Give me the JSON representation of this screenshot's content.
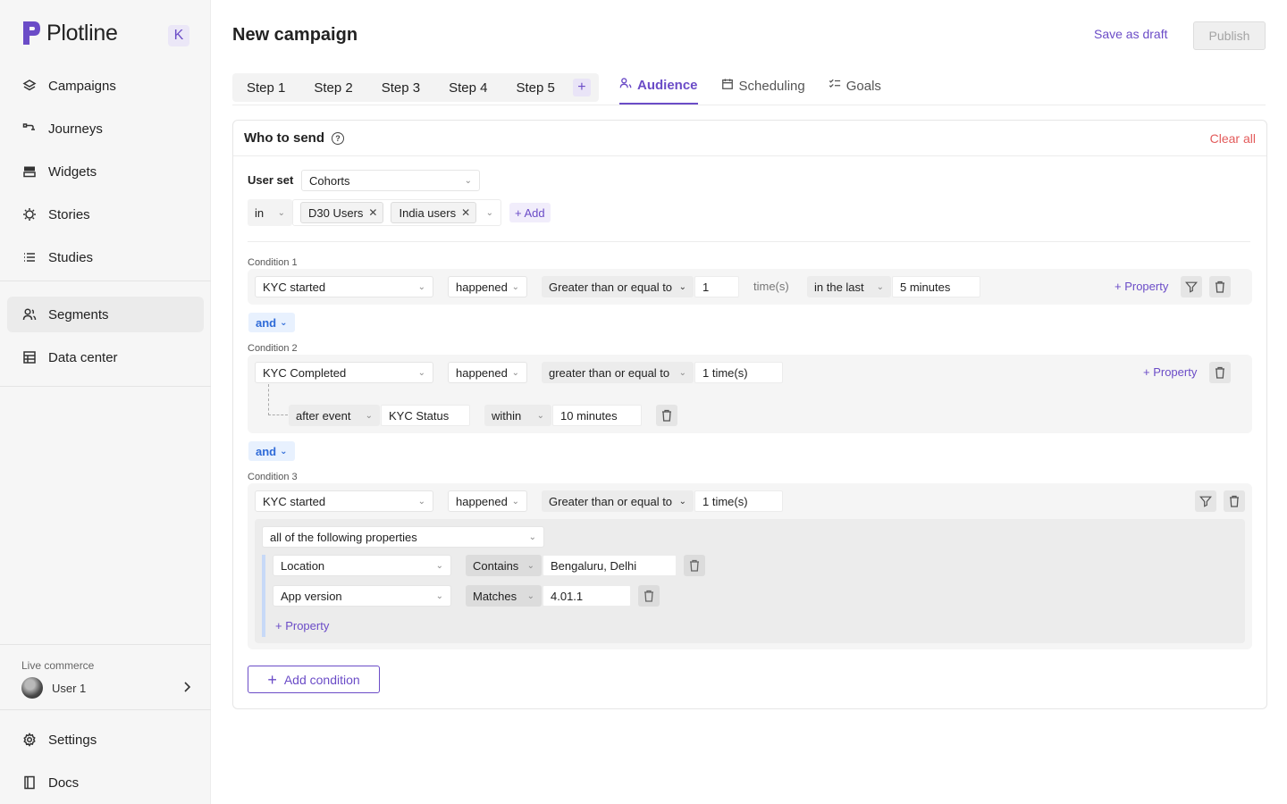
{
  "brand": {
    "name": "Plotline",
    "collapse_key": "K"
  },
  "sidebar": {
    "items": [
      {
        "label": "Campaigns",
        "icon": "layers-icon"
      },
      {
        "label": "Journeys",
        "icon": "journey-icon"
      },
      {
        "label": "Widgets",
        "icon": "widget-icon"
      },
      {
        "label": "Stories",
        "icon": "sun-icon"
      },
      {
        "label": "Studies",
        "icon": "list-icon"
      },
      {
        "label": "Segments",
        "icon": "users-icon",
        "active": true
      },
      {
        "label": "Data center",
        "icon": "table-icon"
      }
    ],
    "workspace": "Live commerce",
    "user": "User 1",
    "bottom": [
      {
        "label": "Settings",
        "icon": "gear-icon"
      },
      {
        "label": "Docs",
        "icon": "book-icon"
      }
    ]
  },
  "header": {
    "title": "New campaign",
    "save_draft": "Save as draft",
    "publish": "Publish"
  },
  "steps": [
    "Step 1",
    "Step 2",
    "Step 3",
    "Step 4",
    "Step 5"
  ],
  "tabs": [
    {
      "label": "Audience",
      "icon": "audience-icon",
      "active": true
    },
    {
      "label": "Scheduling",
      "icon": "calendar-icon"
    },
    {
      "label": "Goals",
      "icon": "checklist-icon"
    }
  ],
  "card": {
    "title": "Who to send",
    "clear_all": "Clear all"
  },
  "user_set": {
    "label": "User set",
    "value": "Cohorts",
    "operator": "in",
    "chips": [
      "D30 Users",
      "India users"
    ],
    "add": "+ Add"
  },
  "conditions": {
    "c1": {
      "label": "Condition 1",
      "event": "KYC started",
      "verb": "happened",
      "comparator": "Greater than or equal to",
      "count": "1",
      "unit": "time(s)",
      "window": "in the last",
      "window_value": "5 minutes",
      "property": "+ Property"
    },
    "and1": "and",
    "c2": {
      "label": "Condition 2",
      "event": "KYC Completed",
      "verb": "happened",
      "comparator": "greater than or equal to",
      "count": "1 time(s)",
      "property": "+ Property",
      "sub": {
        "relation": "after event",
        "event": "KYC Status",
        "window": "within",
        "window_value": "10 minutes"
      }
    },
    "and2": "and",
    "c3": {
      "label": "Condition 3",
      "event": "KYC started",
      "verb": "happened",
      "comparator": "Greater than or equal to",
      "count": "1 time(s)",
      "match": "all of the following properties",
      "props": [
        {
          "name": "Location",
          "op": "Contains",
          "value": "Bengaluru, Delhi"
        },
        {
          "name": "App version",
          "op": "Matches",
          "value": "4.01.1"
        }
      ],
      "add_property": "+ Property"
    }
  },
  "add_condition": "Add condition",
  "colors": {
    "accent": "#6b4cc7",
    "danger": "#e35b5b",
    "and_blue": "#2f6bd8"
  }
}
